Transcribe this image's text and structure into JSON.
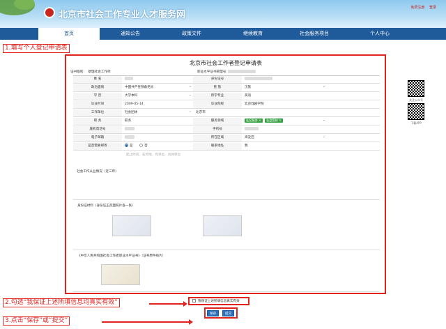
{
  "header": {
    "site_title": "北京市社会工作专业人才服务网",
    "links": [
      "免费注册",
      "登录"
    ]
  },
  "nav": {
    "items": [
      "首页",
      "通知公告",
      "政策文件",
      "继续教育",
      "社会服务项目",
      "个人中心"
    ],
    "active_index": 0
  },
  "annotations": {
    "step1": "1.填写个人登记申请表",
    "step2": "2.勾选“我保证上述所填信息均真实有效”",
    "step3": "3.点击“保存”或“提交”"
  },
  "form": {
    "title": "北京市社会工作者登记申请表",
    "meta_left_label": "证书级别:",
    "meta_left_value": "助理社会工作师",
    "meta_right_label": "职业水平证书管理号:",
    "rows": [
      {
        "l1": "姓 名",
        "v1": "",
        "l2": "身份证号",
        "v2": ""
      },
      {
        "l1": "政治面貌",
        "v1": "中国共产党预备党员",
        "l2": "民 族",
        "v2": "汉族"
      },
      {
        "l1": "学 历",
        "v1": "大学本科",
        "l2": "所学专业",
        "v2": "英语"
      },
      {
        "l1": "毕业时间",
        "v1": "2009-05-14",
        "l2": "毕业院校",
        "v2": "北京戏剧学院"
      },
      {
        "l1": "工作单位",
        "v1": "社会团体",
        "l2": "",
        "v2": "北京市"
      },
      {
        "l1": "职 务",
        "v1": "职务",
        "l2": "服务领域",
        "v2": ""
      },
      {
        "l1": "座机电话号",
        "v1": "",
        "l2": "手机号",
        "v2": ""
      },
      {
        "l1": "电子邮箱",
        "v1": "",
        "l2": "所在区域",
        "v2": "海淀区"
      },
      {
        "l1": "是否需要邮寄",
        "v1": "",
        "l2": "联系地址",
        "v2": "我"
      }
    ],
    "service_tags": [
      "社区服务 ×",
      "社会团体 ×"
    ],
    "mail_options": [
      "是",
      "否"
    ],
    "work_label": "社会工作从业情况（近三年）",
    "work_placeholder": "起止时间、在何地、何单位、具体单位",
    "idcard_label": "身份证材料（身份证正反面照片各一张）",
    "cert_label": "《中华人民共和国社会工作者职业水平证书》（证书原件照片）",
    "guarantee_text": "我保证上述所填信息真实有效",
    "save_label": "保存",
    "submit_label": "提交"
  },
  "sidebar": {
    "qr_captions": [
      "关注公众号",
      "下载APP"
    ]
  }
}
